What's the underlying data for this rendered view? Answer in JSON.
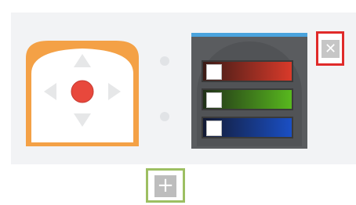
{
  "canvas": {
    "nodes": [
      {
        "name": "joystick-node",
        "icon": "dpad-icon",
        "accent_color": "#f4a146"
      },
      {
        "name": "color-sensor-node",
        "icon": "rgb-sliders-icon",
        "accent_color": "#4aa3dd",
        "channels": [
          {
            "name": "red",
            "color": "#d93a2a",
            "checked": false
          },
          {
            "name": "green",
            "color": "#58b81e",
            "checked": false
          },
          {
            "name": "blue",
            "color": "#1a4fc4",
            "checked": false
          }
        ]
      }
    ],
    "delete_button": {
      "icon": "close-icon",
      "glyph": "✕",
      "border_color": "#e02a2a"
    },
    "add_button": {
      "icon": "plus-icon",
      "glyph": "+",
      "border_color": "#9dbf62"
    }
  }
}
